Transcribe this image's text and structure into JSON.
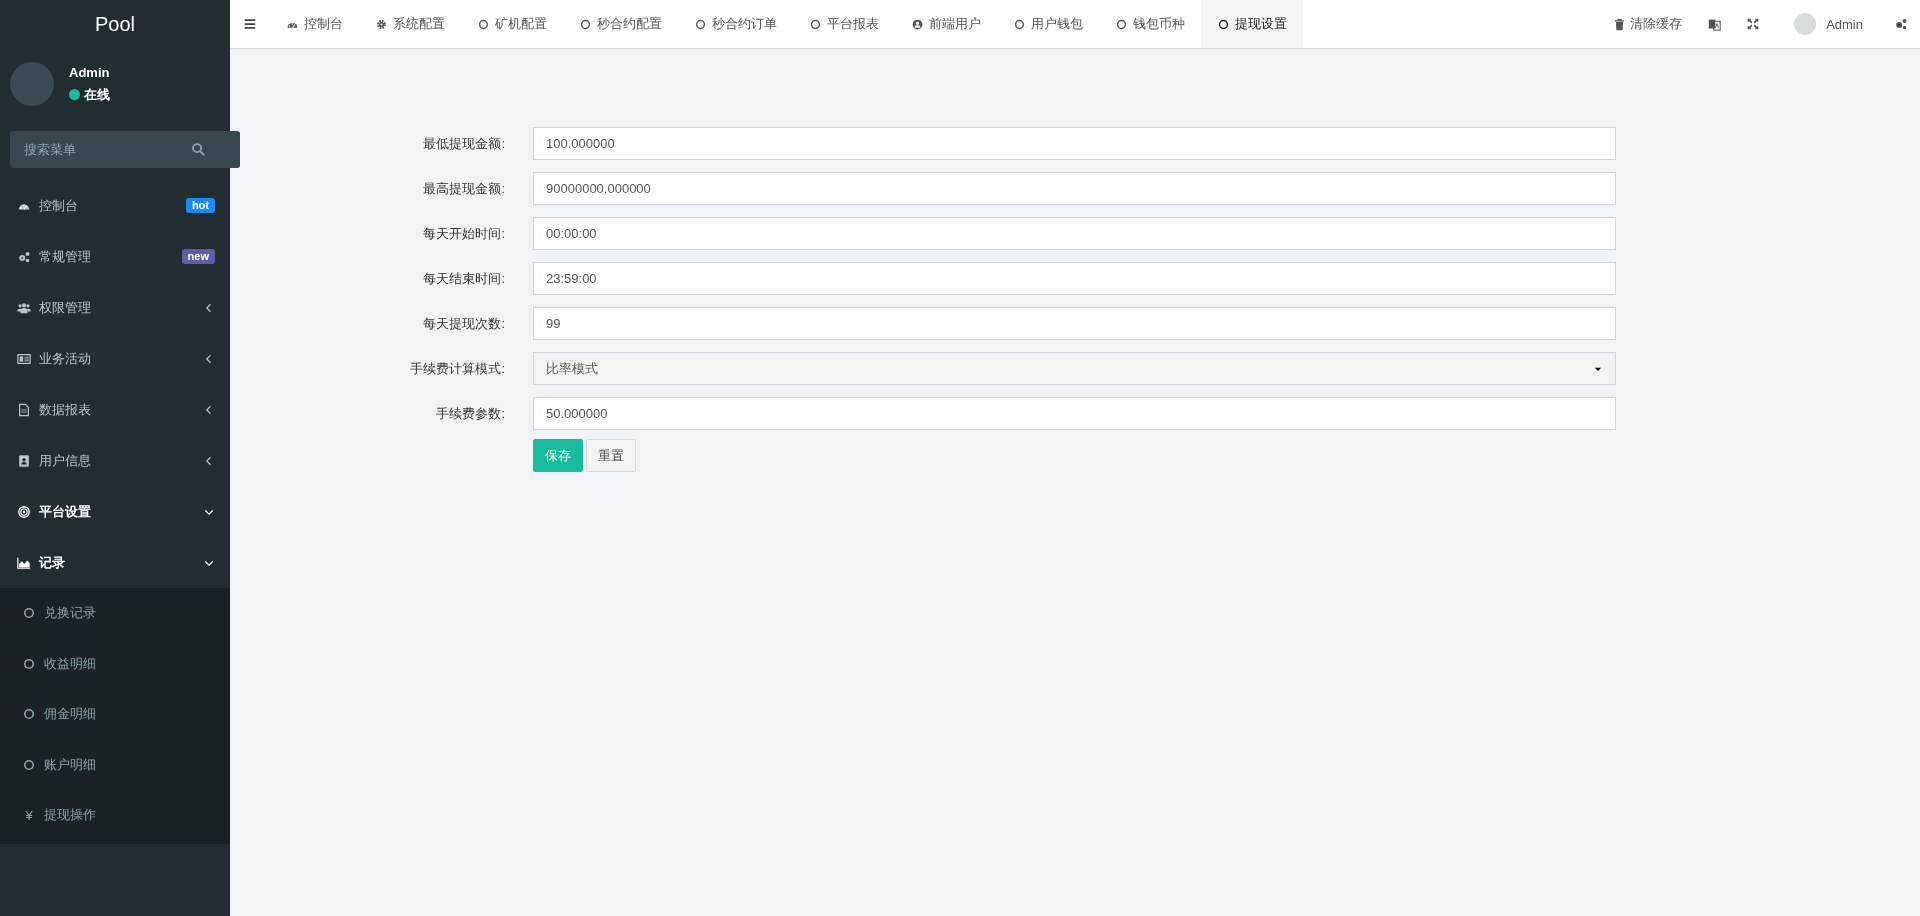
{
  "sidebar": {
    "logo": "Pool",
    "user": {
      "name": "Admin",
      "status": "在线"
    },
    "search": {
      "placeholder": "搜索菜单"
    },
    "menu": [
      {
        "label": "控制台",
        "kind": "badge",
        "badge": "hot",
        "color": "#1b8cf2"
      },
      {
        "label": "常规管理",
        "kind": "badge",
        "badge": "new",
        "color": "#605ca8"
      },
      {
        "label": "权限管理",
        "kind": "group",
        "expanded": false
      },
      {
        "label": "业务活动",
        "kind": "group",
        "expanded": false
      },
      {
        "label": "数据报表",
        "kind": "group",
        "expanded": false
      },
      {
        "label": "用户信息",
        "kind": "group",
        "expanded": false
      },
      {
        "label": "平台设置",
        "kind": "group",
        "expanded": true
      },
      {
        "label": "记录",
        "kind": "group",
        "expanded": true,
        "children": [
          {
            "label": "兑换记录"
          },
          {
            "label": "收益明细"
          },
          {
            "label": "佣金明细"
          },
          {
            "label": "账户明细"
          },
          {
            "label": "提现操作",
            "glyph": "¥"
          }
        ]
      }
    ]
  },
  "tabs": [
    {
      "label": "控制台",
      "selected": false
    },
    {
      "label": "系统配置",
      "selected": false
    },
    {
      "label": "矿机配置",
      "selected": false
    },
    {
      "label": "秒合约配置",
      "selected": false
    },
    {
      "label": "秒合约订单",
      "selected": false
    },
    {
      "label": "平台报表",
      "selected": false
    },
    {
      "label": "前端用户",
      "selected": false
    },
    {
      "label": "用户钱包",
      "selected": false
    },
    {
      "label": "钱包币种",
      "selected": false
    },
    {
      "label": "提现设置",
      "selected": true
    }
  ],
  "toolbar": {
    "clear_cache": "清除缓存",
    "user": "Admin"
  },
  "form": {
    "fields": [
      {
        "label": "最低提现金额:",
        "kind": "input",
        "value": "100.000000"
      },
      {
        "label": "最高提现金额:",
        "kind": "input",
        "value": "90000000.000000"
      },
      {
        "label": "每天开始时间:",
        "kind": "input",
        "value": "00:00:00"
      },
      {
        "label": "每天结束时间:",
        "kind": "input",
        "value": "23:59:00"
      },
      {
        "label": "每天提现次数:",
        "kind": "input",
        "value": "99"
      },
      {
        "label": "手续费计算模式:",
        "kind": "select",
        "value": "比率模式"
      },
      {
        "label": "手续费参数:",
        "kind": "input",
        "value": "50.000000"
      }
    ],
    "buttons": [
      {
        "label": "保存",
        "kind": "primary"
      },
      {
        "label": "重置",
        "kind": "default"
      }
    ]
  }
}
